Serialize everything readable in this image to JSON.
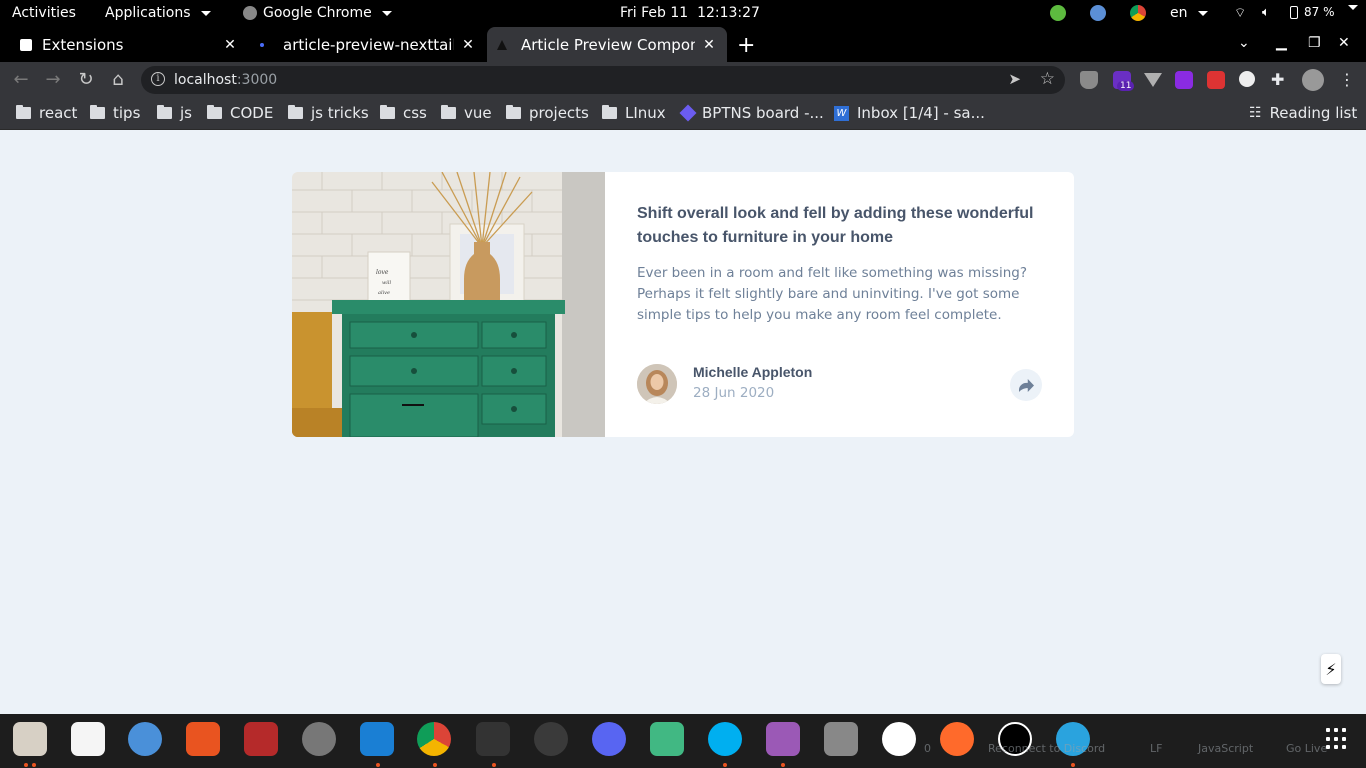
{
  "system_bar": {
    "activities": "Activities",
    "applications": "Applications",
    "active_app": "Google Chrome",
    "clock": "Fri Feb 11  12:13:27",
    "language": "en",
    "battery": "87 %"
  },
  "browser": {
    "tabs": [
      {
        "title": "Extensions",
        "active": false
      },
      {
        "title": "article-preview-nexttailwi",
        "active": false
      },
      {
        "title": "Article Preview Compone",
        "active": true
      }
    ],
    "url_host": "localhost",
    "url_port": ":3000",
    "extension_badge": "11",
    "bookmarks": [
      {
        "label": "react",
        "icon": "folder-icon"
      },
      {
        "label": "tips",
        "icon": "folder-icon"
      },
      {
        "label": "js",
        "icon": "folder-icon"
      },
      {
        "label": "CODE",
        "icon": "folder-icon"
      },
      {
        "label": "js tricks",
        "icon": "folder-icon"
      },
      {
        "label": "css",
        "icon": "folder-icon"
      },
      {
        "label": "vue",
        "icon": "folder-icon"
      },
      {
        "label": "projects",
        "icon": "folder-icon"
      },
      {
        "label": "LInux",
        "icon": "folder-icon"
      },
      {
        "label": "BPTNS board -...",
        "icon": "board-icon"
      },
      {
        "label": "Inbox [1/4] - sa...",
        "icon": "mail-icon"
      }
    ],
    "reading_list": "Reading list"
  },
  "article": {
    "headline": "Shift overall look and fell by adding these wonderful touches to furniture in your home",
    "description": "Ever been in a room and felt like something was missing? Perhaps it felt slightly bare and uninviting. I've got some simple tips to help you make any room feel complete.",
    "author_name": "Michelle Appleton",
    "date": "28 Jun 2020"
  },
  "statusbar": {
    "count": "0",
    "discord": "Reconnect to Discord",
    "eol": "LF",
    "language": "JavaScript",
    "golive": "Go Live"
  },
  "colors": {
    "page_bg": "#ECF2F8",
    "heading": "#48556A",
    "body_text": "#6E8098",
    "muted": "#9DAEC2"
  }
}
